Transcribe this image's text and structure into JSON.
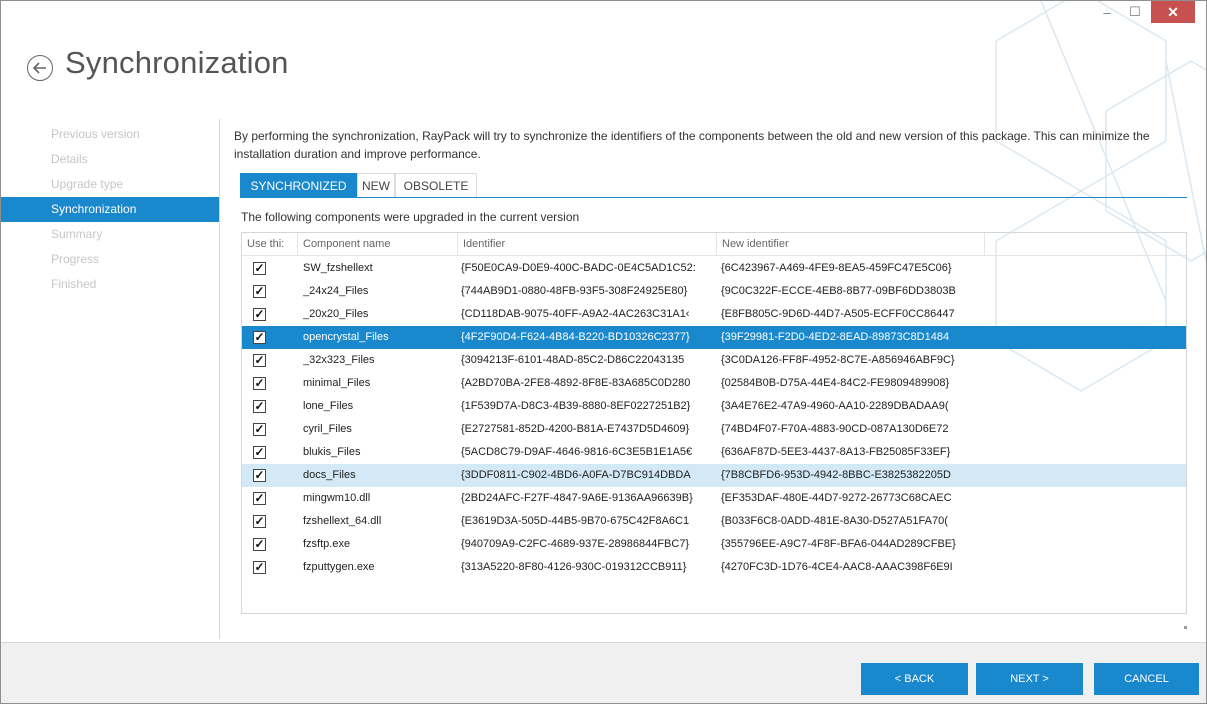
{
  "window": {
    "title": "Synchronization",
    "controls": {
      "minimize": "–",
      "maximize": "☐",
      "close": "✕"
    }
  },
  "steps": [
    {
      "label": "Previous version",
      "active": false
    },
    {
      "label": "Details",
      "active": false
    },
    {
      "label": "Upgrade type",
      "active": false
    },
    {
      "label": "Synchronization",
      "active": true
    },
    {
      "label": "Summary",
      "active": false
    },
    {
      "label": "Progress",
      "active": false
    },
    {
      "label": "Finished",
      "active": false
    }
  ],
  "description": "By performing the synchronization, RayPack will try to synchronize the identifiers of the components between the old and new version of this package. This can minimize the installation duration and improve performance.",
  "tabs": [
    "SYNCHRONIZED",
    "NEW",
    "OBSOLETE"
  ],
  "subtitle": "The following components were upgraded in the current version",
  "grid": {
    "headers": [
      "Use thi:",
      "Component name",
      "Identifier",
      "New identifier"
    ],
    "rows": [
      {
        "checked": "✓",
        "name": "SW_fzshellext",
        "id": "{F50E0CA9-D0E9-400C-BADC-0E4C5AD1C52:",
        "new_id": "{6C423967-A469-4FE9-8EA5-459FC47E5C06}",
        "state": "normal"
      },
      {
        "checked": "✓",
        "name": "_24x24_Files",
        "id": "{744AB9D1-0880-48FB-93F5-308F24925E80}",
        "new_id": "{9C0C322F-ECCE-4EB8-8B77-09BF6DD3803B",
        "state": "normal"
      },
      {
        "checked": "✓",
        "name": "_20x20_Files",
        "id": "{CD118DAB-9075-40FF-A9A2-4AC263C31A1‹",
        "new_id": "{E8FB805C-9D6D-44D7-A505-ECFF0CC86447",
        "state": "normal"
      },
      {
        "checked": "✓",
        "name": "opencrystal_Files",
        "id": "{4F2F90D4-F624-4B84-B220-BD10326C2377}",
        "new_id": "{39F29981-F2D0-4ED2-8EAD-89873C8D1484",
        "state": "selected"
      },
      {
        "checked": "✓",
        "name": "_32x323_Files",
        "id": "{3094213F-6101-48AD-85C2-D86C22043135",
        "new_id": "{3C0DA126-FF8F-4952-8C7E-A856946ABF9C}",
        "state": "normal"
      },
      {
        "checked": "✓",
        "name": "minimal_Files",
        "id": "{A2BD70BA-2FE8-4892-8F8E-83A685C0D280",
        "new_id": "{02584B0B-D75A-44E4-84C2-FE9809489908}",
        "state": "normal"
      },
      {
        "checked": "✓",
        "name": "lone_Files",
        "id": "{1F539D7A-D8C3-4B39-8880-8EF0227251B2}",
        "new_id": "{3A4E76E2-47A9-4960-AA10-2289DBADAA9(",
        "state": "normal"
      },
      {
        "checked": "✓",
        "name": "cyril_Files",
        "id": "{E2727581-852D-4200-B81A-E7437D5D4609}",
        "new_id": "{74BD4F07-F70A-4883-90CD-087A130D6E72",
        "state": "normal"
      },
      {
        "checked": "✓",
        "name": "blukis_Files",
        "id": "{5ACD8C79-D9AF-4646-9816-6C3E5B1E1A5€",
        "new_id": "{636AF87D-5EE3-4437-8A13-FB25085F33EF}",
        "state": "normal"
      },
      {
        "checked": "✓",
        "name": "docs_Files",
        "id": "{3DDF0811-C902-4BD6-A0FA-D7BC914DBDA",
        "new_id": "{7B8CBFD6-953D-4942-8BBC-E3825382205D",
        "state": "hover"
      },
      {
        "checked": "✓",
        "name": "mingwm10.dll",
        "id": "{2BD24AFC-F27F-4847-9A6E-9136AA96639B}",
        "new_id": "{EF353DAF-480E-44D7-9272-26773C68CAEC",
        "state": "normal"
      },
      {
        "checked": "✓",
        "name": "fzshellext_64.dll",
        "id": "{E3619D3A-505D-44B5-9B70-675C42F8A6C1",
        "new_id": "{B033F6C8-0ADD-481E-8A30-D527A51FA70(",
        "state": "normal"
      },
      {
        "checked": "✓",
        "name": "fzsftp.exe",
        "id": "{940709A9-C2FC-4689-937E-28986844FBC7}",
        "new_id": "{355796EE-A9C7-4F8F-BFA6-044AD289CFBE}",
        "state": "normal"
      },
      {
        "checked": "✓",
        "name": "fzputtygen.exe",
        "id": "{313A5220-8F80-4126-930C-019312CCB911}",
        "new_id": "{4270FC3D-1D76-4CE4-AAC8-AAAC398F6E9I",
        "state": "normal"
      }
    ]
  },
  "footer": {
    "back": "< BACK",
    "next": "NEXT >",
    "cancel": "CANCEL"
  },
  "colors": {
    "accent": "#1a88cc",
    "hover_row": "#d3e9f6",
    "close": "#c75050"
  }
}
